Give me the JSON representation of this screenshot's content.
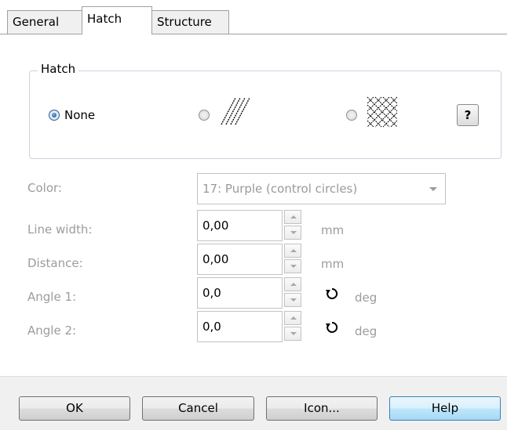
{
  "tabs": [
    {
      "label": "General",
      "active": false
    },
    {
      "label": "Hatch",
      "active": true
    },
    {
      "label": "Structure",
      "active": false
    }
  ],
  "hatch_group": {
    "title": "Hatch",
    "options": [
      {
        "label": "None",
        "checked": true,
        "icon": "no-hatch"
      },
      {
        "label": "",
        "checked": false,
        "icon": "single-hatch-icon"
      },
      {
        "label": "",
        "checked": false,
        "icon": "cross-hatch-icon"
      }
    ],
    "help_label": "?"
  },
  "form": {
    "color": {
      "label": "Color:",
      "value": "17: Purple (control circles)"
    },
    "line_width": {
      "label": "Line width:",
      "value": "0,00",
      "unit": "mm"
    },
    "distance": {
      "label": "Distance:",
      "value": "0,00",
      "unit": "mm"
    },
    "angle1": {
      "label": "Angle 1:",
      "value": "0,0",
      "unit": "deg"
    },
    "angle2": {
      "label": "Angle 2:",
      "value": "0,0",
      "unit": "deg"
    }
  },
  "buttons": {
    "ok": "OK",
    "cancel": "Cancel",
    "icon": "Icon...",
    "help": "Help"
  }
}
